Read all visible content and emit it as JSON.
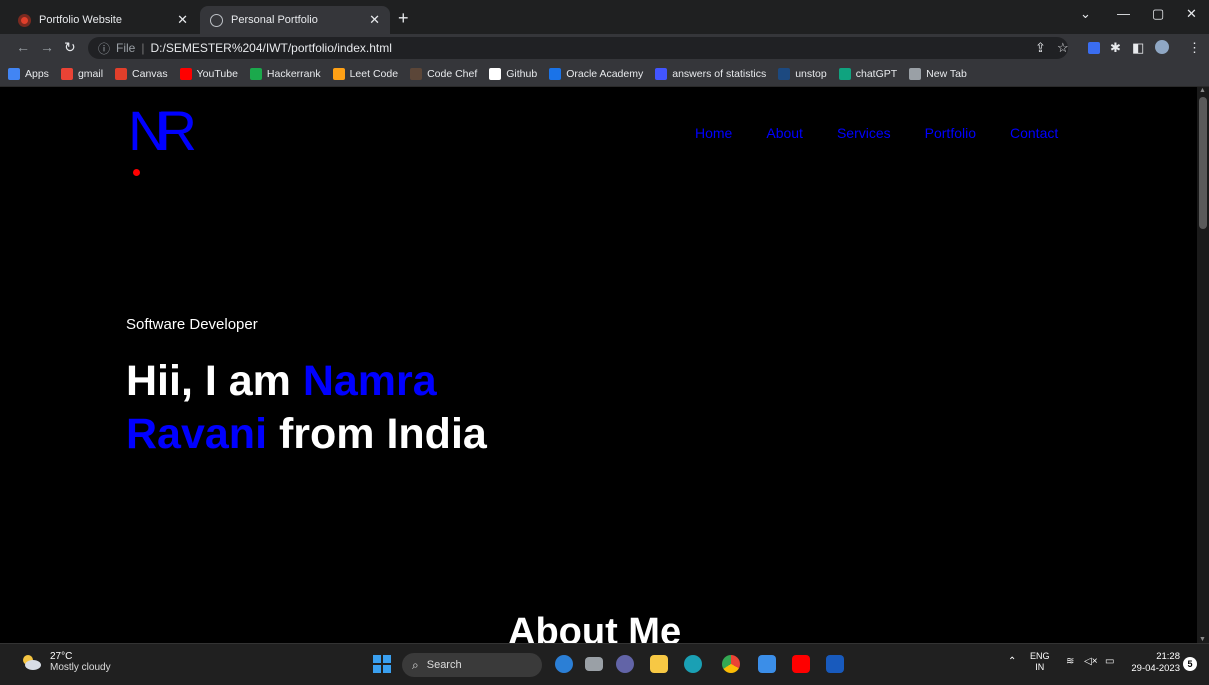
{
  "browser": {
    "tabs": [
      {
        "label": "Portfolio Website",
        "active": false
      },
      {
        "label": "Personal Portfolio",
        "active": true
      }
    ],
    "url_prefix": "File",
    "url": "D:/SEMESTER%204/IWT/portfolio/index.html",
    "bookmarks": [
      {
        "label": "Apps",
        "icon": "apps-grid-icon",
        "color": "#4285f4"
      },
      {
        "label": "gmail",
        "icon": "gmail-icon",
        "color": "#ea4335"
      },
      {
        "label": "Canvas",
        "icon": "canvas-icon",
        "color": "#e13f2b"
      },
      {
        "label": "YouTube",
        "icon": "youtube-icon",
        "color": "#ff0000"
      },
      {
        "label": "Hackerrank",
        "icon": "hackerrank-icon",
        "color": "#1ba94c"
      },
      {
        "label": "Leet Code",
        "icon": "leetcode-icon",
        "color": "#ffa116"
      },
      {
        "label": "Code Chef",
        "icon": "codechef-icon",
        "color": "#5b4638"
      },
      {
        "label": "Github",
        "icon": "github-icon",
        "color": "#ffffff"
      },
      {
        "label": "Oracle Academy",
        "icon": "oracle-icon",
        "color": "#1a73e8"
      },
      {
        "label": "answers of statistics",
        "icon": "quizlet-icon",
        "color": "#4255ff"
      },
      {
        "label": "unstop",
        "icon": "unstop-icon",
        "color": "#1c4980"
      },
      {
        "label": "chatGPT",
        "icon": "chatgpt-icon",
        "color": "#10a37f"
      },
      {
        "label": "New Tab",
        "icon": "globe-icon",
        "color": "#9aa0a6"
      }
    ]
  },
  "site": {
    "logo": "NR",
    "nav": [
      "Home",
      "About",
      "Services",
      "Portfolio",
      "Contact"
    ],
    "subtitle": "Software Developer",
    "hero": {
      "prefix": "Hii, I am ",
      "name_first": "Namra",
      "name_last": "Ravani",
      "suffix": " from India"
    },
    "about_heading": "About Me",
    "colors": {
      "accent": "#0000ff",
      "dot": "#ff0000",
      "background": "#000000",
      "text": "#ffffff"
    }
  },
  "taskbar": {
    "weather_temp": "27°C",
    "weather_cond": "Mostly cloudy",
    "search_label": "Search",
    "lang_1": "ENG",
    "lang_2": "IN",
    "time": "21:28",
    "date": "29-04-2023",
    "notifications": "5"
  }
}
